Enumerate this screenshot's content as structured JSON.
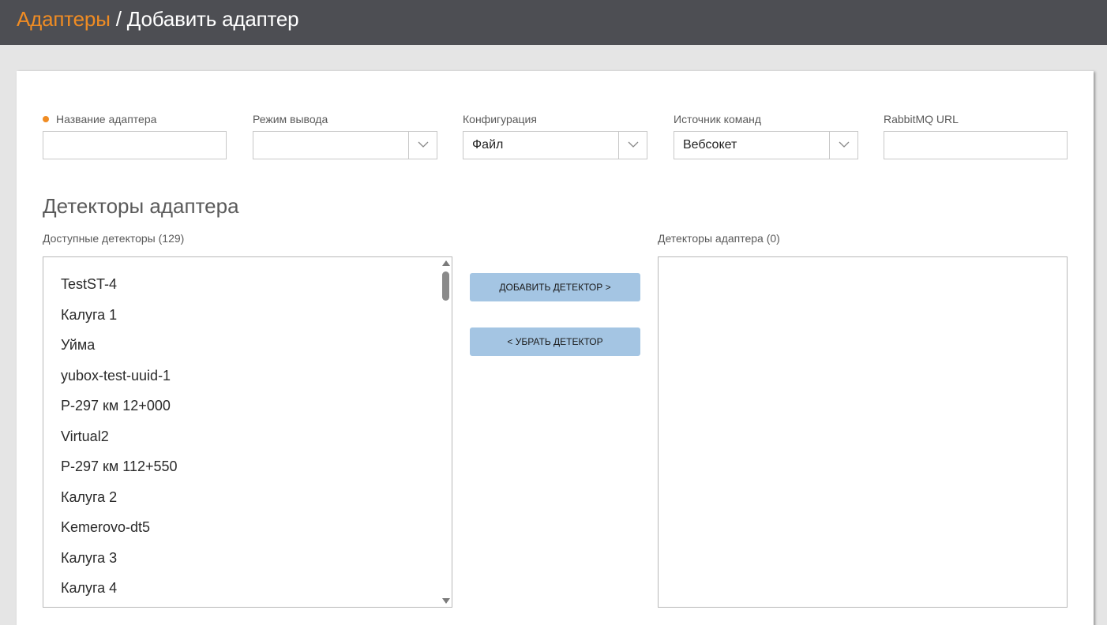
{
  "header": {
    "breadcrumb_link": "Адаптеры",
    "breadcrumb_separator": " / ",
    "page_title": "Добавить адаптер"
  },
  "form": {
    "adapter_name": {
      "label": "Название адаптера",
      "value": "",
      "required": true
    },
    "output_mode": {
      "label": "Режим вывода",
      "value": ""
    },
    "configuration": {
      "label": "Конфигурация",
      "value": "Файл"
    },
    "command_source": {
      "label": "Источник команд",
      "value": "Вебсокет"
    },
    "rabbitmq_url": {
      "label": "RabbitMQ URL",
      "value": ""
    }
  },
  "detectors": {
    "section_title": "Детекторы адаптера",
    "available_label": "Доступные детекторы (129)",
    "assigned_label": "Детекторы адаптера (0)",
    "available_items": [
      "TestST-4",
      "Калуга 1",
      "Уйма",
      "yubox-test-uuid-1",
      "Р-297 км 12+000",
      "Virtual2",
      "Р-297 км 112+550",
      "Калуга 2",
      "Kemerovo-dt5",
      "Калуга 3",
      "Калуга 4"
    ],
    "assigned_items": [],
    "add_button": "ДОБАВИТЬ ДЕТЕКТОР >",
    "remove_button": "< УБРАТЬ ДЕТЕКТОР"
  },
  "colors": {
    "header_bg": "#4d4e53",
    "accent": "#f08c23",
    "button_bg": "#a4c5e3",
    "page_bg": "#e5e5e5"
  }
}
